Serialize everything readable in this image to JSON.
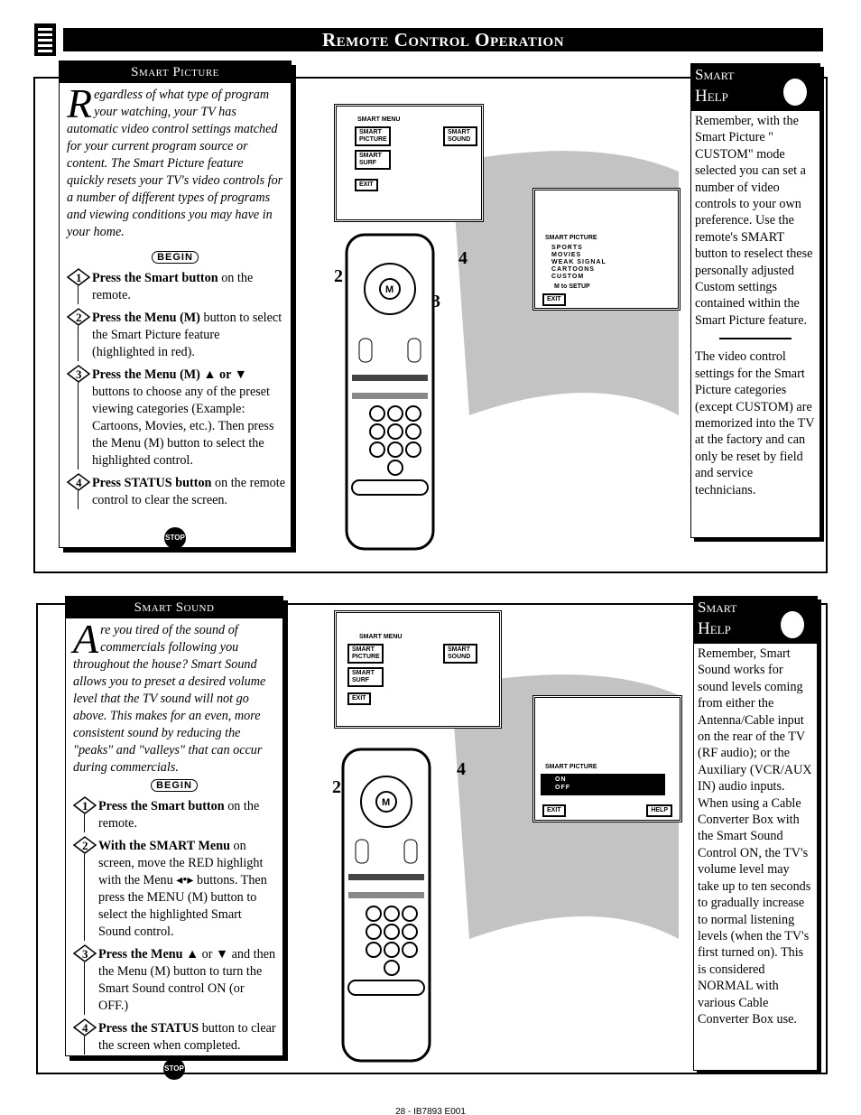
{
  "header": {
    "title": "Remote Control Operation",
    "icon": "remote-control-icon"
  },
  "section1": {
    "title": "Smart Picture",
    "intro_drop": "R",
    "intro": "egardless of what type of program your watching, your TV has automatic video control settings matched for your current program source or content. The Smart Picture feature quickly resets your TV's video controls for a number of different types of programs and viewing conditions you may have in your home.",
    "begin": "BEGIN",
    "steps": [
      {
        "num": "1",
        "bold": "Press the Smart button",
        "text": " on the remote."
      },
      {
        "num": "2",
        "bold": "Press the Menu (M)",
        "text": " button to select the Smart Picture feature (highlighted in red)."
      },
      {
        "num": "3",
        "bold": "Press the Menu (M) ▲ or ▼",
        "text": " buttons to choose any of the preset viewing categories (Example: Cartoons, Movies, etc.). Then press the Menu (M) button to select the highlighted control."
      },
      {
        "num": "4",
        "bold": "Press STATUS button",
        "text": " on the remote control to clear the screen."
      }
    ],
    "stop": "STOP",
    "help_title_1": "Smart",
    "help_title_2": "Help",
    "help_p1": "Remember, with the Smart Picture \" CUSTOM\" mode selected you can set a number of video controls to your own preference. Use the remote's SMART button to reselect these personally adjusted Custom settings contained within the Smart Picture feature.",
    "help_p2": "The video control settings for the Smart Picture categories (except CUSTOM) are memorized into the TV at the factory and can only be reset by field and service technicians.",
    "menu": {
      "title": "SMART MENU",
      "picture": "SMART PICTURE",
      "sound": "SMART SOUND",
      "surf": "SMART SURF",
      "exit": "EXIT"
    },
    "submenu": {
      "title": "SMART PICTURE",
      "options": [
        "SPORTS",
        "MOVIES",
        "WEAK SIGNAL",
        "CARTOONS",
        "CUSTOM"
      ],
      "setup": "M to SETUP",
      "exit": "EXIT"
    }
  },
  "section2": {
    "title": "Smart Sound",
    "intro_drop": "A",
    "intro": "re you tired of the sound of commercials following you throughout the house? Smart Sound allows you to preset a desired volume level that the TV sound will not go above. This makes for an even, more consistent sound by reducing the \"peaks\" and \"valleys\" that can occur during commercials.",
    "begin": "BEGIN",
    "steps": [
      {
        "num": "1",
        "bold": "Press the Smart button",
        "text": " on the remote."
      },
      {
        "num": "2",
        "bold": "With the SMART Menu",
        "text": " on screen, move the RED highlight with the Menu ◂•▸ buttons. Then press the MENU (M) button to select the highlighted Smart Sound control."
      },
      {
        "num": "3",
        "bold": "Press the Menu ▲",
        "text": " or ▼ and then the Menu (M) button to turn the Smart Sound control ON (or OFF.)"
      },
      {
        "num": "4",
        "bold": "Press the STATUS",
        "text": " button to clear the screen when completed."
      }
    ],
    "stop": "STOP",
    "help_title_1": "Smart",
    "help_title_2": "Help",
    "help_p1": "Remember, Smart Sound works for sound levels coming from either the Antenna/Cable input on the rear of the TV (RF audio); or the Auxiliary (VCR/AUX IN) audio inputs. When using a Cable Converter Box with the Smart Sound Control ON, the TV's volume level may take up to ten seconds to gradually increase to normal listening levels (when the TV's first turned on). This is considered NORMAL with various Cable Converter Box use.",
    "menu": {
      "title": "SMART MENU",
      "picture": "SMART PICTURE",
      "sound": "SMART SOUND",
      "surf": "SMART SURF",
      "exit": "EXIT"
    },
    "submenu": {
      "title": "SMART PICTURE",
      "options": [
        "ON",
        "OFF"
      ],
      "exit": "EXIT",
      "help": "HELP"
    }
  },
  "footer": "28 - IB7893 E001"
}
